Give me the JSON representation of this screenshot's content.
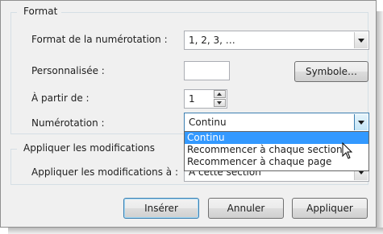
{
  "format": {
    "group_title": "Format",
    "numbering_format_label": "Format de la numérotation :",
    "numbering_format_value": "1, 2, 3, …",
    "custom_label": "Personnalisée :",
    "custom_value": "",
    "symbol_button": "Symbole…",
    "start_at_label": "À partir de :",
    "start_at_value": "1",
    "numbering_label": "Numérotation :",
    "numbering_value": "Continu"
  },
  "dropdown": {
    "options": [
      "Continu",
      "Recommencer à chaque section",
      "Recommencer à chaque page"
    ],
    "selected": "Continu"
  },
  "apply": {
    "group_title": "Appliquer les modifications",
    "apply_to_label": "Appliquer les modifications à :",
    "apply_to_value": "À cette section"
  },
  "buttons": {
    "insert": "Insérer",
    "cancel": "Annuler",
    "apply": "Appliquer"
  },
  "colors": {
    "selection": "#3399ff",
    "dialog_bg": "#f0f0f0",
    "focus_border": "#3c7fb1"
  },
  "icons": {
    "dropdown_arrow": "chevron-down-icon",
    "spinner_up": "chevron-up-icon",
    "spinner_down": "chevron-down-icon",
    "cursor": "mouse-pointer-icon"
  }
}
